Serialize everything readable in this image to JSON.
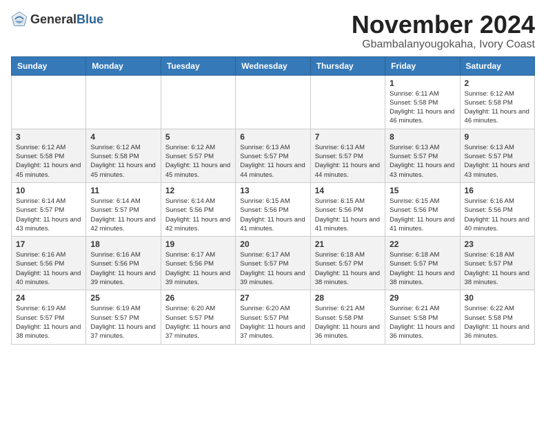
{
  "logo": {
    "general": "General",
    "blue": "Blue"
  },
  "header": {
    "title": "November 2024",
    "subtitle": "Gbambalanyougokaha, Ivory Coast"
  },
  "weekdays": [
    "Sunday",
    "Monday",
    "Tuesday",
    "Wednesday",
    "Thursday",
    "Friday",
    "Saturday"
  ],
  "weeks": [
    [
      {
        "day": "",
        "info": ""
      },
      {
        "day": "",
        "info": ""
      },
      {
        "day": "",
        "info": ""
      },
      {
        "day": "",
        "info": ""
      },
      {
        "day": "",
        "info": ""
      },
      {
        "day": "1",
        "info": "Sunrise: 6:11 AM\nSunset: 5:58 PM\nDaylight: 11 hours and 46 minutes."
      },
      {
        "day": "2",
        "info": "Sunrise: 6:12 AM\nSunset: 5:58 PM\nDaylight: 11 hours and 46 minutes."
      }
    ],
    [
      {
        "day": "3",
        "info": "Sunrise: 6:12 AM\nSunset: 5:58 PM\nDaylight: 11 hours and 45 minutes."
      },
      {
        "day": "4",
        "info": "Sunrise: 6:12 AM\nSunset: 5:58 PM\nDaylight: 11 hours and 45 minutes."
      },
      {
        "day": "5",
        "info": "Sunrise: 6:12 AM\nSunset: 5:57 PM\nDaylight: 11 hours and 45 minutes."
      },
      {
        "day": "6",
        "info": "Sunrise: 6:13 AM\nSunset: 5:57 PM\nDaylight: 11 hours and 44 minutes."
      },
      {
        "day": "7",
        "info": "Sunrise: 6:13 AM\nSunset: 5:57 PM\nDaylight: 11 hours and 44 minutes."
      },
      {
        "day": "8",
        "info": "Sunrise: 6:13 AM\nSunset: 5:57 PM\nDaylight: 11 hours and 43 minutes."
      },
      {
        "day": "9",
        "info": "Sunrise: 6:13 AM\nSunset: 5:57 PM\nDaylight: 11 hours and 43 minutes."
      }
    ],
    [
      {
        "day": "10",
        "info": "Sunrise: 6:14 AM\nSunset: 5:57 PM\nDaylight: 11 hours and 43 minutes."
      },
      {
        "day": "11",
        "info": "Sunrise: 6:14 AM\nSunset: 5:57 PM\nDaylight: 11 hours and 42 minutes."
      },
      {
        "day": "12",
        "info": "Sunrise: 6:14 AM\nSunset: 5:56 PM\nDaylight: 11 hours and 42 minutes."
      },
      {
        "day": "13",
        "info": "Sunrise: 6:15 AM\nSunset: 5:56 PM\nDaylight: 11 hours and 41 minutes."
      },
      {
        "day": "14",
        "info": "Sunrise: 6:15 AM\nSunset: 5:56 PM\nDaylight: 11 hours and 41 minutes."
      },
      {
        "day": "15",
        "info": "Sunrise: 6:15 AM\nSunset: 5:56 PM\nDaylight: 11 hours and 41 minutes."
      },
      {
        "day": "16",
        "info": "Sunrise: 6:16 AM\nSunset: 5:56 PM\nDaylight: 11 hours and 40 minutes."
      }
    ],
    [
      {
        "day": "17",
        "info": "Sunrise: 6:16 AM\nSunset: 5:56 PM\nDaylight: 11 hours and 40 minutes."
      },
      {
        "day": "18",
        "info": "Sunrise: 6:16 AM\nSunset: 5:56 PM\nDaylight: 11 hours and 39 minutes."
      },
      {
        "day": "19",
        "info": "Sunrise: 6:17 AM\nSunset: 5:56 PM\nDaylight: 11 hours and 39 minutes."
      },
      {
        "day": "20",
        "info": "Sunrise: 6:17 AM\nSunset: 5:57 PM\nDaylight: 11 hours and 39 minutes."
      },
      {
        "day": "21",
        "info": "Sunrise: 6:18 AM\nSunset: 5:57 PM\nDaylight: 11 hours and 38 minutes."
      },
      {
        "day": "22",
        "info": "Sunrise: 6:18 AM\nSunset: 5:57 PM\nDaylight: 11 hours and 38 minutes."
      },
      {
        "day": "23",
        "info": "Sunrise: 6:18 AM\nSunset: 5:57 PM\nDaylight: 11 hours and 38 minutes."
      }
    ],
    [
      {
        "day": "24",
        "info": "Sunrise: 6:19 AM\nSunset: 5:57 PM\nDaylight: 11 hours and 38 minutes."
      },
      {
        "day": "25",
        "info": "Sunrise: 6:19 AM\nSunset: 5:57 PM\nDaylight: 11 hours and 37 minutes."
      },
      {
        "day": "26",
        "info": "Sunrise: 6:20 AM\nSunset: 5:57 PM\nDaylight: 11 hours and 37 minutes."
      },
      {
        "day": "27",
        "info": "Sunrise: 6:20 AM\nSunset: 5:57 PM\nDaylight: 11 hours and 37 minutes."
      },
      {
        "day": "28",
        "info": "Sunrise: 6:21 AM\nSunset: 5:58 PM\nDaylight: 11 hours and 36 minutes."
      },
      {
        "day": "29",
        "info": "Sunrise: 6:21 AM\nSunset: 5:58 PM\nDaylight: 11 hours and 36 minutes."
      },
      {
        "day": "30",
        "info": "Sunrise: 6:22 AM\nSunset: 5:58 PM\nDaylight: 11 hours and 36 minutes."
      }
    ]
  ]
}
